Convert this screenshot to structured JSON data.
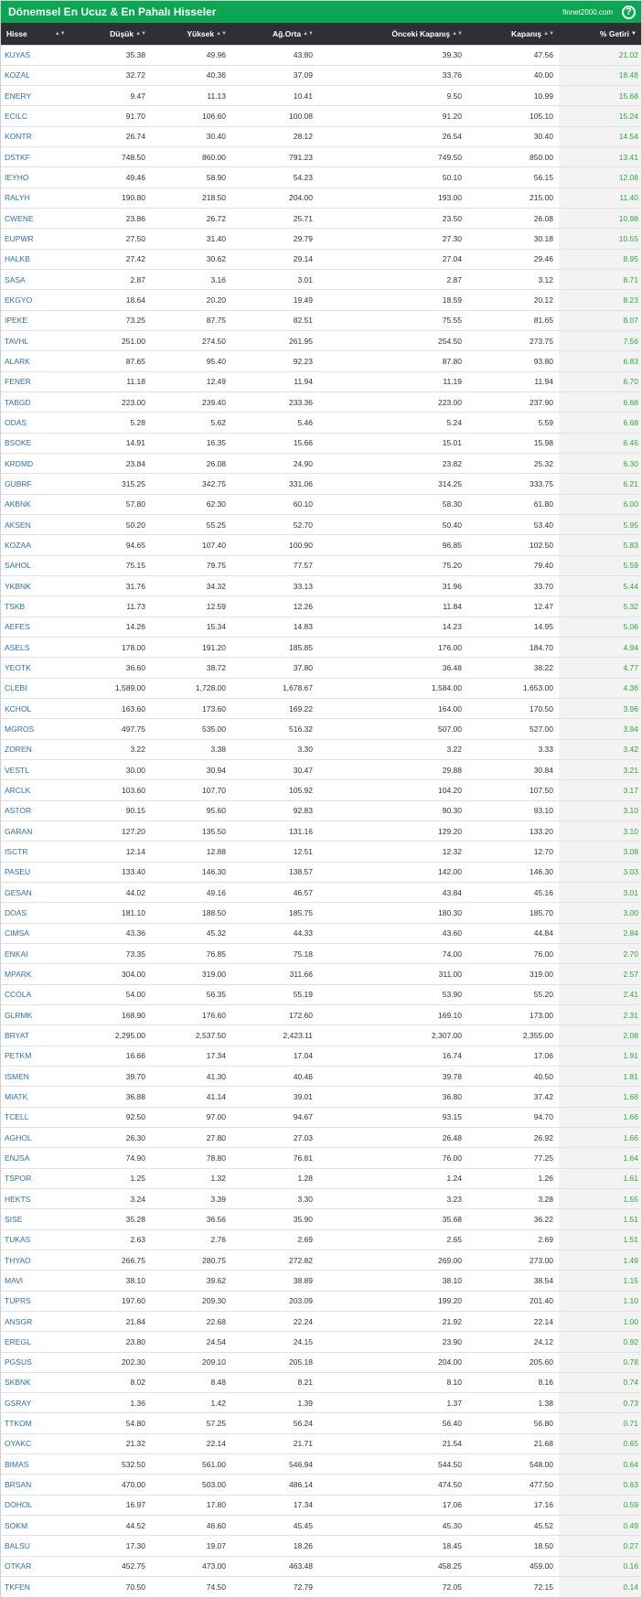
{
  "header": {
    "title": "Dönemsel En Ucuz & En Pahalı Hisseler",
    "brand": "finnet2000.com",
    "help_icon": "?"
  },
  "columns": {
    "symbol": "Hisse",
    "low": "Düşük",
    "high": "Yüksek",
    "wavg": "Ağ.Orta",
    "prev_close": "Önceki Kapanış",
    "close": "Kapanış",
    "return": "% Getiri"
  },
  "sort_icons": {
    "both": "▲▼",
    "desc": "▼"
  },
  "rows": [
    [
      "KUYAS",
      "35.38",
      "49.96",
      "43.80",
      "39.30",
      "47.56",
      "21.02"
    ],
    [
      "KOZAL",
      "32.72",
      "40.36",
      "37.09",
      "33.76",
      "40.00",
      "18.48"
    ],
    [
      "ENERY",
      "9.47",
      "11.13",
      "10.41",
      "9.50",
      "10.99",
      "15.68"
    ],
    [
      "ECILC",
      "91.70",
      "106.60",
      "100.08",
      "91.20",
      "105.10",
      "15.24"
    ],
    [
      "KONTR",
      "26.74",
      "30.40",
      "28.12",
      "26.54",
      "30.40",
      "14.54"
    ],
    [
      "DSTKF",
      "748.50",
      "860.00",
      "791.23",
      "749.50",
      "850.00",
      "13.41"
    ],
    [
      "IEYHO",
      "49.46",
      "58.90",
      "54.23",
      "50.10",
      "56.15",
      "12.08"
    ],
    [
      "RALYH",
      "190.80",
      "218.50",
      "204.00",
      "193.00",
      "215.00",
      "11.40"
    ],
    [
      "CWENE",
      "23.86",
      "26.72",
      "25.71",
      "23.50",
      "26.08",
      "10.98"
    ],
    [
      "EUPWR",
      "27.50",
      "31.40",
      "29.79",
      "27.30",
      "30.18",
      "10.55"
    ],
    [
      "HALKB",
      "27.42",
      "30.62",
      "29.14",
      "27.04",
      "29.46",
      "8.95"
    ],
    [
      "SASA",
      "2.87",
      "3.16",
      "3.01",
      "2.87",
      "3.12",
      "8.71"
    ],
    [
      "EKGYO",
      "18.64",
      "20.20",
      "19.49",
      "18.59",
      "20.12",
      "8.23"
    ],
    [
      "IPEKE",
      "73.25",
      "87.75",
      "82.51",
      "75.55",
      "81.65",
      "8.07"
    ],
    [
      "TAVHL",
      "251.00",
      "274.50",
      "261.95",
      "254.50",
      "273.75",
      "7.56"
    ],
    [
      "ALARK",
      "87.65",
      "95.40",
      "92.23",
      "87.80",
      "93.80",
      "6.83"
    ],
    [
      "FENER",
      "11.18",
      "12.49",
      "11.94",
      "11.19",
      "11.94",
      "6.70"
    ],
    [
      "TABGD",
      "223.00",
      "239.40",
      "233.36",
      "223.00",
      "237.90",
      "6.68"
    ],
    [
      "ODAS",
      "5.28",
      "5.62",
      "5.46",
      "5.24",
      "5.59",
      "6.68"
    ],
    [
      "BSOKE",
      "14.91",
      "16.35",
      "15.66",
      "15.01",
      "15.98",
      "6.46"
    ],
    [
      "KRDMD",
      "23.84",
      "26.08",
      "24.90",
      "23.82",
      "25.32",
      "6.30"
    ],
    [
      "GUBRF",
      "315.25",
      "342.75",
      "331.06",
      "314.25",
      "333.75",
      "6.21"
    ],
    [
      "AKBNK",
      "57.80",
      "62.30",
      "60.10",
      "58.30",
      "61.80",
      "6.00"
    ],
    [
      "AKSEN",
      "50.20",
      "55.25",
      "52.70",
      "50.40",
      "53.40",
      "5.95"
    ],
    [
      "KOZAA",
      "94.65",
      "107.40",
      "100.90",
      "96.85",
      "102.50",
      "5.83"
    ],
    [
      "SAHOL",
      "75.15",
      "79.75",
      "77.57",
      "75.20",
      "79.40",
      "5.59"
    ],
    [
      "YKBNK",
      "31.76",
      "34.32",
      "33.13",
      "31.96",
      "33.70",
      "5.44"
    ],
    [
      "TSKB",
      "11.73",
      "12.59",
      "12.26",
      "11.84",
      "12.47",
      "5.32"
    ],
    [
      "AEFES",
      "14.26",
      "15.34",
      "14.83",
      "14.23",
      "14.95",
      "5.06"
    ],
    [
      "ASELS",
      "178.00",
      "191.20",
      "185.85",
      "176.00",
      "184.70",
      "4.94"
    ],
    [
      "YEOTK",
      "36.60",
      "38.72",
      "37.80",
      "36.48",
      "38.22",
      "4.77"
    ],
    [
      "CLEBI",
      "1,589.00",
      "1,728.00",
      "1,678.67",
      "1,584.00",
      "1,653.00",
      "4.36"
    ],
    [
      "KCHOL",
      "163.60",
      "173.60",
      "169.22",
      "164.00",
      "170.50",
      "3.96"
    ],
    [
      "MGROS",
      "497.75",
      "535.00",
      "516.32",
      "507.00",
      "527.00",
      "3.94"
    ],
    [
      "ZOREN",
      "3.22",
      "3.38",
      "3.30",
      "3.22",
      "3.33",
      "3.42"
    ],
    [
      "VESTL",
      "30.00",
      "30.94",
      "30.47",
      "29.88",
      "30.84",
      "3.21"
    ],
    [
      "ARCLK",
      "103.60",
      "107.70",
      "105.92",
      "104.20",
      "107.50",
      "3.17"
    ],
    [
      "ASTOR",
      "90.15",
      "95.60",
      "92.83",
      "90.30",
      "93.10",
      "3.10"
    ],
    [
      "GARAN",
      "127.20",
      "135.50",
      "131.16",
      "129.20",
      "133.20",
      "3.10"
    ],
    [
      "ISCTR",
      "12.14",
      "12.88",
      "12.51",
      "12.32",
      "12.70",
      "3.08"
    ],
    [
      "PASEU",
      "133.40",
      "146.30",
      "138.57",
      "142.00",
      "146.30",
      "3.03"
    ],
    [
      "GESAN",
      "44.02",
      "49.16",
      "46.57",
      "43.84",
      "45.16",
      "3.01"
    ],
    [
      "DOAS",
      "181.10",
      "188.50",
      "185.75",
      "180.30",
      "185.70",
      "3.00"
    ],
    [
      "CIMSA",
      "43.36",
      "45.32",
      "44.33",
      "43.60",
      "44.84",
      "2.84"
    ],
    [
      "ENKAI",
      "73.35",
      "76.85",
      "75.18",
      "74.00",
      "76.00",
      "2.70"
    ],
    [
      "MPARK",
      "304.00",
      "319.00",
      "311.66",
      "311.00",
      "319.00",
      "2.57"
    ],
    [
      "CCOLA",
      "54.00",
      "56.35",
      "55.19",
      "53.90",
      "55.20",
      "2.41"
    ],
    [
      "GLRMK",
      "168.90",
      "176.60",
      "172.60",
      "169.10",
      "173.00",
      "2.31"
    ],
    [
      "BRYAT",
      "2,295.00",
      "2,537.50",
      "2,423.11",
      "2,307.00",
      "2,355.00",
      "2.08"
    ],
    [
      "PETKM",
      "16.66",
      "17.34",
      "17.04",
      "16.74",
      "17.06",
      "1.91"
    ],
    [
      "ISMEN",
      "39.70",
      "41.30",
      "40.46",
      "39.78",
      "40.50",
      "1.81"
    ],
    [
      "MIATK",
      "36.88",
      "41.14",
      "39.01",
      "36.80",
      "37.42",
      "1.68"
    ],
    [
      "TCELL",
      "92.50",
      "97.00",
      "94.67",
      "93.15",
      "94.70",
      "1.66"
    ],
    [
      "AGHOL",
      "26.30",
      "27.80",
      "27.03",
      "26.48",
      "26.92",
      "1.66"
    ],
    [
      "ENJSA",
      "74.90",
      "78.80",
      "76.81",
      "76.00",
      "77.25",
      "1.64"
    ],
    [
      "TSPOR",
      "1.25",
      "1.32",
      "1.28",
      "1.24",
      "1.26",
      "1.61"
    ],
    [
      "HEKTS",
      "3.24",
      "3.39",
      "3.30",
      "3.23",
      "3.28",
      "1.55"
    ],
    [
      "SISE",
      "35.28",
      "36.56",
      "35.90",
      "35.68",
      "36.22",
      "1.51"
    ],
    [
      "TUKAS",
      "2.63",
      "2.76",
      "2.69",
      "2.65",
      "2.69",
      "1.51"
    ],
    [
      "THYAO",
      "266.75",
      "280.75",
      "272.82",
      "269.00",
      "273.00",
      "1.49"
    ],
    [
      "MAVI",
      "38.10",
      "39.62",
      "38.89",
      "38.10",
      "38.54",
      "1.15"
    ],
    [
      "TUPRS",
      "197.60",
      "209.30",
      "203.09",
      "199.20",
      "201.40",
      "1.10"
    ],
    [
      "ANSGR",
      "21.84",
      "22.68",
      "22.24",
      "21.92",
      "22.14",
      "1.00"
    ],
    [
      "EREGL",
      "23.80",
      "24.54",
      "24.15",
      "23.90",
      "24.12",
      "0.92"
    ],
    [
      "PGSUS",
      "202.30",
      "209.10",
      "205.18",
      "204.00",
      "205.60",
      "0.78"
    ],
    [
      "SKBNK",
      "8.02",
      "8.48",
      "8.21",
      "8.10",
      "8.16",
      "0.74"
    ],
    [
      "GSRAY",
      "1.36",
      "1.42",
      "1.39",
      "1.37",
      "1.38",
      "0.73"
    ],
    [
      "TTKOM",
      "54.80",
      "57.25",
      "56.24",
      "56.40",
      "56.80",
      "0.71"
    ],
    [
      "OYAKC",
      "21.32",
      "22.14",
      "21.71",
      "21.54",
      "21.68",
      "0.65"
    ],
    [
      "BIMAS",
      "532.50",
      "561.00",
      "546.94",
      "544.50",
      "548.00",
      "0.64"
    ],
    [
      "BRSAN",
      "470.00",
      "503.00",
      "486.14",
      "474.50",
      "477.50",
      "0.63"
    ],
    [
      "DOHOL",
      "16.97",
      "17.80",
      "17.34",
      "17.06",
      "17.16",
      "0.59"
    ],
    [
      "SOKM",
      "44.52",
      "46.60",
      "45.45",
      "45.30",
      "45.52",
      "0.49"
    ],
    [
      "BALSU",
      "17.30",
      "19.07",
      "18.26",
      "18.45",
      "18.50",
      "0.27"
    ],
    [
      "OTKAR",
      "452.75",
      "473.00",
      "463.48",
      "458.25",
      "459.00",
      "0.16"
    ],
    [
      "TKFEN",
      "70.50",
      "74.50",
      "72.79",
      "72.05",
      "72.15",
      "0.14"
    ]
  ]
}
